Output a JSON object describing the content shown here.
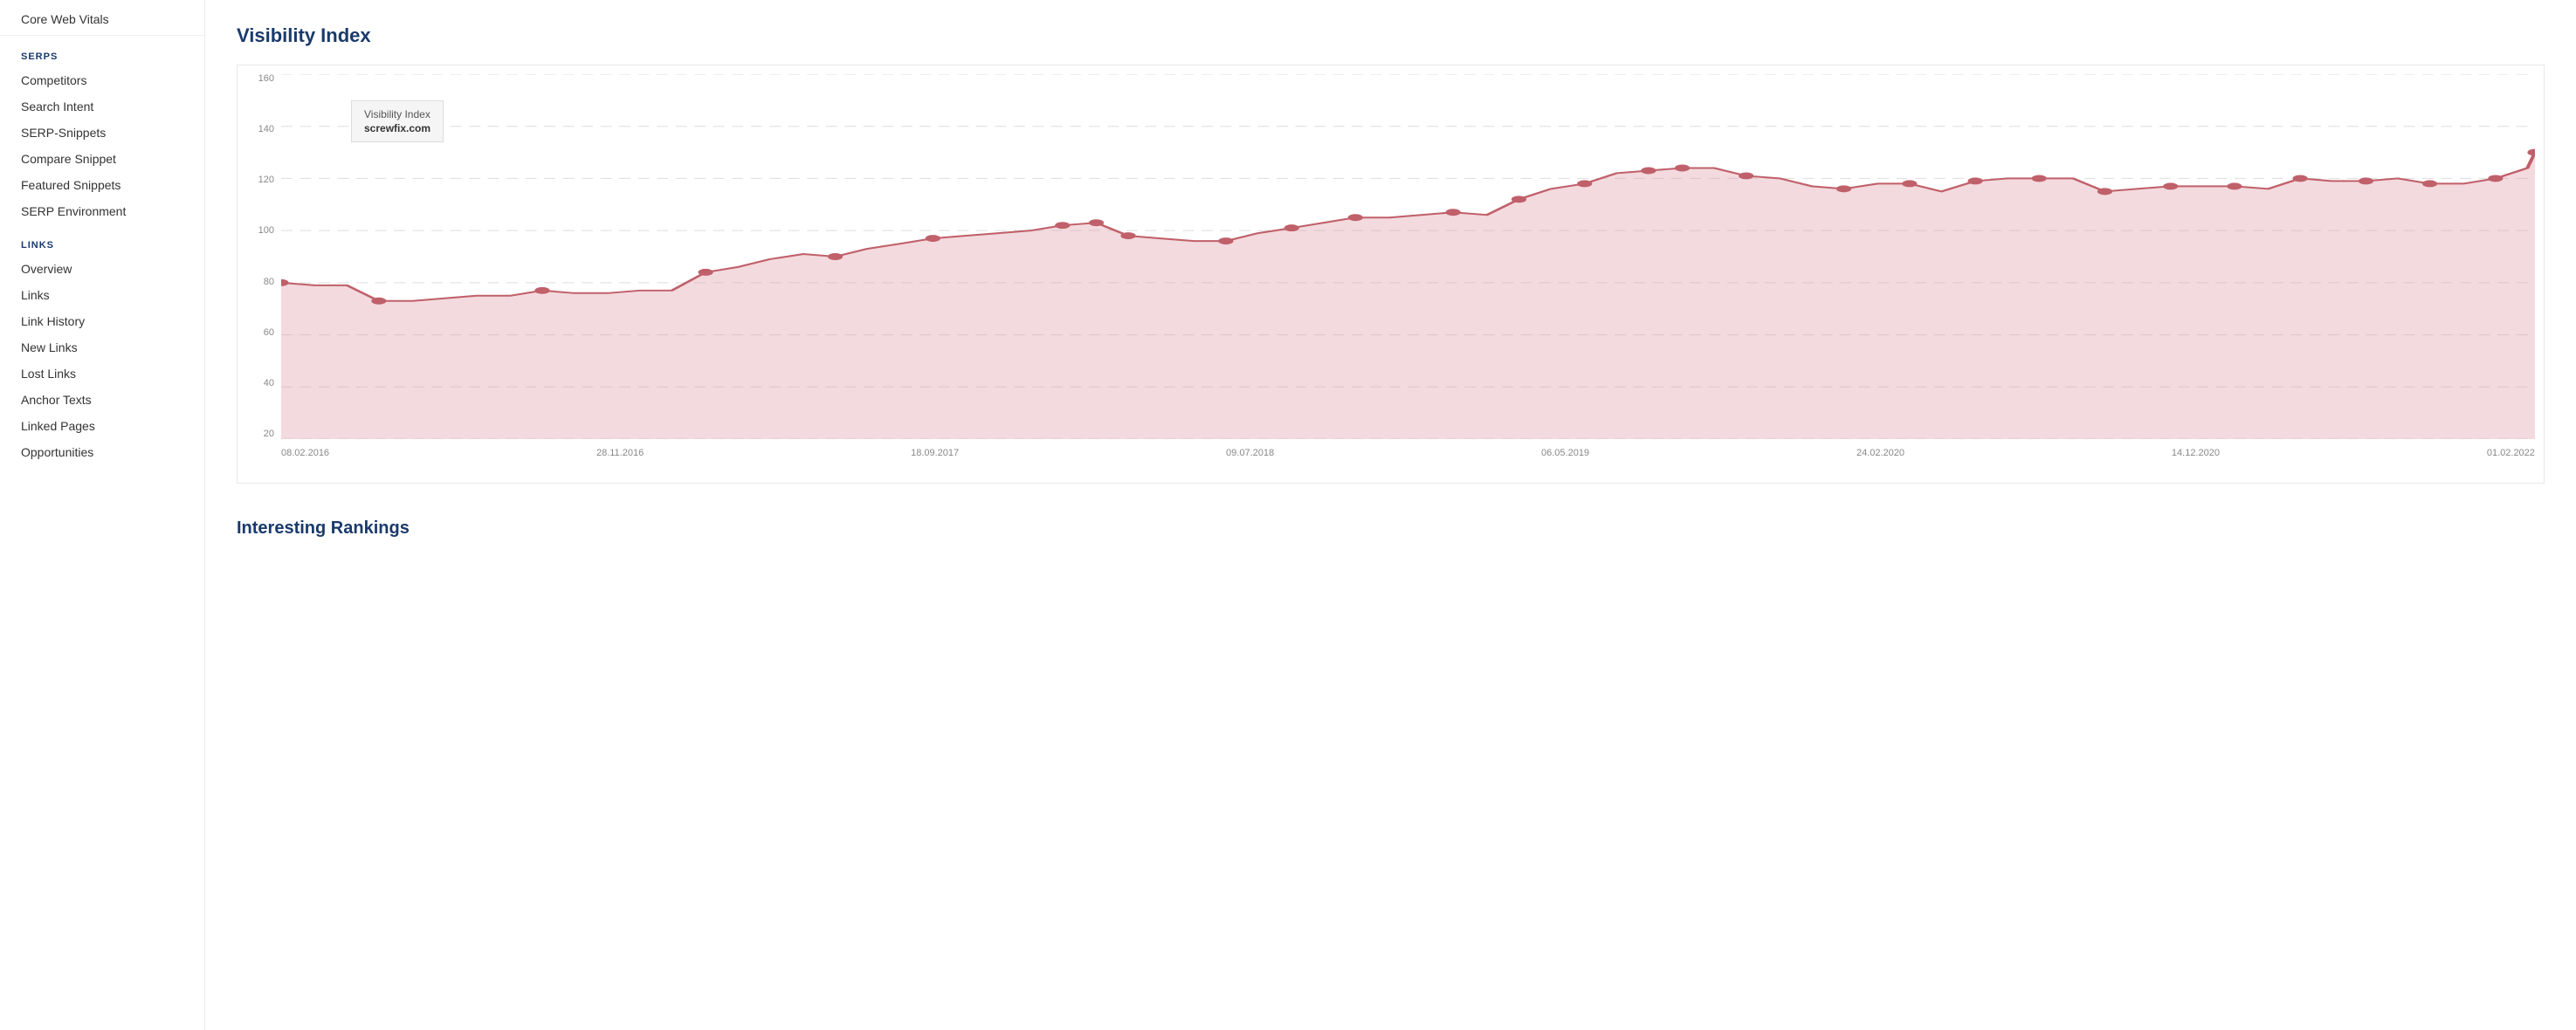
{
  "sidebar": {
    "top_items": [
      {
        "label": "Core Web Vitals",
        "active": false
      }
    ],
    "sections": [
      {
        "label": "SERPS",
        "items": [
          {
            "label": "Competitors",
            "active": false
          },
          {
            "label": "Search Intent",
            "active": false
          },
          {
            "label": "SERP-Snippets",
            "active": false
          },
          {
            "label": "Compare Snippet",
            "active": false
          },
          {
            "label": "Featured Snippets",
            "active": false
          },
          {
            "label": "SERP Environment",
            "active": false
          }
        ]
      },
      {
        "label": "LINKS",
        "items": [
          {
            "label": "Overview",
            "active": false
          },
          {
            "label": "Links",
            "active": false
          },
          {
            "label": "Link History",
            "active": false
          },
          {
            "label": "New Links",
            "active": false
          },
          {
            "label": "Lost Links",
            "active": false
          },
          {
            "label": "Anchor Texts",
            "active": false
          },
          {
            "label": "Linked Pages",
            "active": false
          },
          {
            "label": "Opportunities",
            "active": false
          }
        ]
      }
    ]
  },
  "chart": {
    "title": "Visibility Index",
    "tooltip": {
      "label": "Visibility Index",
      "value": "screwfix.com"
    },
    "y_labels": [
      "160",
      "140",
      "120",
      "100",
      "80",
      "60",
      "40",
      "20"
    ],
    "x_labels": [
      "08.02.2016",
      "28.11.2016",
      "18.09.2017",
      "09.07.2018",
      "06.05.2019",
      "24.02.2020",
      "14.12.2020",
      "01.02.2022"
    ]
  },
  "interesting_rankings": {
    "title": "Interesting Rankings"
  }
}
